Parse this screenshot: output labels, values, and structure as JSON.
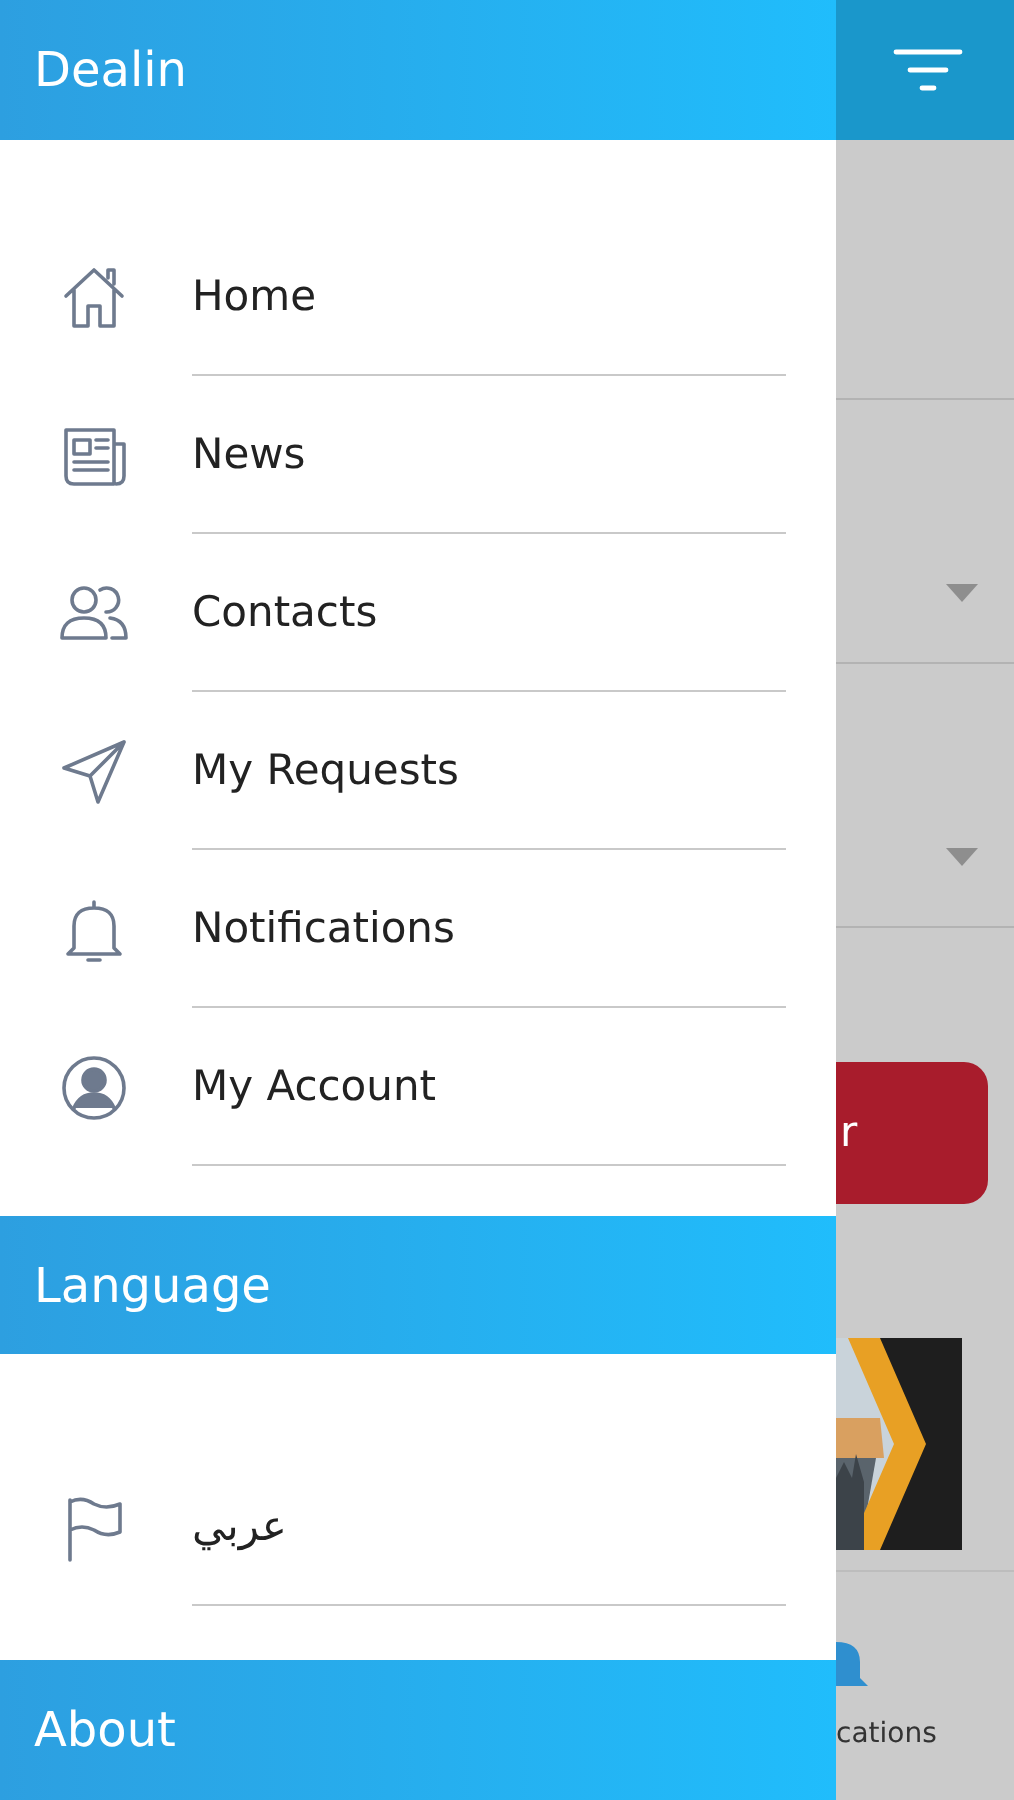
{
  "drawer": {
    "title": "Dealin",
    "menu": [
      {
        "label": "Home",
        "kind": "home"
      },
      {
        "label": "News",
        "kind": "news"
      },
      {
        "label": "Contacts",
        "kind": "contacts"
      },
      {
        "label": "My Requests",
        "kind": "send"
      },
      {
        "label": "Notifications",
        "kind": "bell"
      },
      {
        "label": "My Account",
        "kind": "account"
      }
    ],
    "language_heading": "Language",
    "languages": [
      {
        "label": "عربي",
        "kind": "flag"
      }
    ],
    "about_heading": "About"
  },
  "background": {
    "button_text": "r",
    "bottom_tab": "cations"
  }
}
